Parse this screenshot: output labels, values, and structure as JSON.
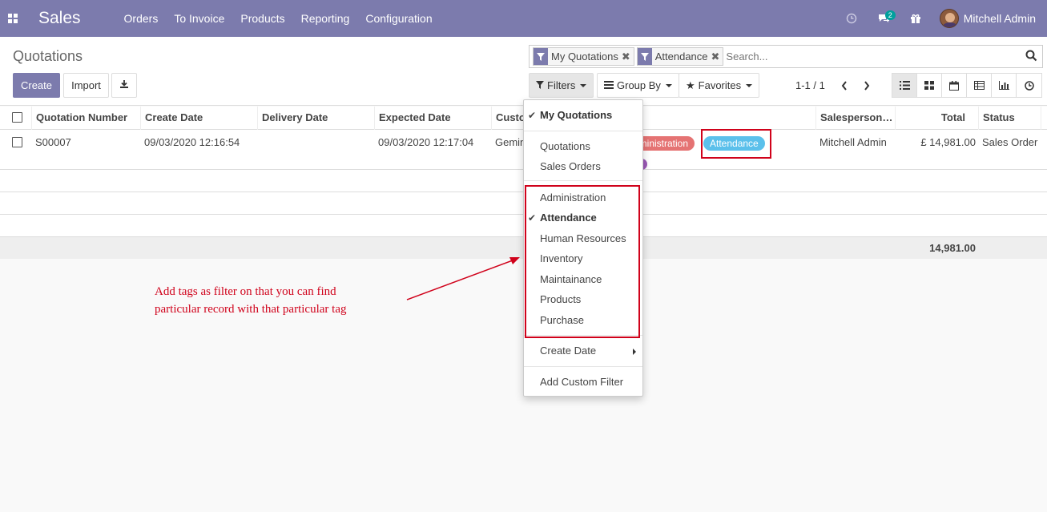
{
  "navbar": {
    "app_name": "Sales",
    "menu": [
      "Orders",
      "To Invoice",
      "Products",
      "Reporting",
      "Configuration"
    ],
    "chat_badge": "2",
    "user_name": "Mitchell Admin",
    "color": "#7c7bad"
  },
  "control_panel": {
    "breadcrumb": "Quotations",
    "create_label": "Create",
    "import_label": "Import",
    "search": {
      "facets": [
        "My Quotations",
        "Attendance"
      ],
      "placeholder": "Search..."
    },
    "filters_label": "Filters",
    "groupby_label": "Group By",
    "favorites_label": "Favorites",
    "pager": "1-1 / 1"
  },
  "table": {
    "headers": [
      "Quotation Number",
      "Create Date",
      "Delivery Date",
      "Expected Date",
      "Custo",
      "Salesperson…",
      "Total",
      "Status"
    ],
    "rows": [
      {
        "number": "S00007",
        "create_date": "09/03/2020 12:16:54",
        "delivery_date": "",
        "expected_date": "09/03/2020 12:17:04",
        "customer": "Gemini",
        "tags": [
          "dministration",
          "Attendance"
        ],
        "salesperson": "Mitchell Admin",
        "total": "£ 14,981.00",
        "status": "Sales Order"
      }
    ],
    "footer_total": "14,981.00"
  },
  "filters_dropdown": {
    "predefined": [
      {
        "label": "My Quotations",
        "checked": true
      }
    ],
    "states": [
      "Quotations",
      "Sales Orders"
    ],
    "tags": [
      {
        "label": "Administration",
        "checked": false
      },
      {
        "label": "Attendance",
        "checked": true
      },
      {
        "label": "Human Resources",
        "checked": false
      },
      {
        "label": "Inventory",
        "checked": false
      },
      {
        "label": "Maintainance",
        "checked": false
      },
      {
        "label": "Products",
        "checked": false
      },
      {
        "label": "Purchase",
        "checked": false
      }
    ],
    "create_date": "Create Date",
    "custom_filter": "Add Custom Filter"
  },
  "annotation": {
    "line1": "Add tags as filter on that you can find",
    "line2": "particular record with that particular tag",
    "color": "#d0021b"
  },
  "colors": {
    "tag_administration": "#e57373",
    "tag_attendance": "#5bc0eb",
    "primary": "#7c7bad"
  }
}
